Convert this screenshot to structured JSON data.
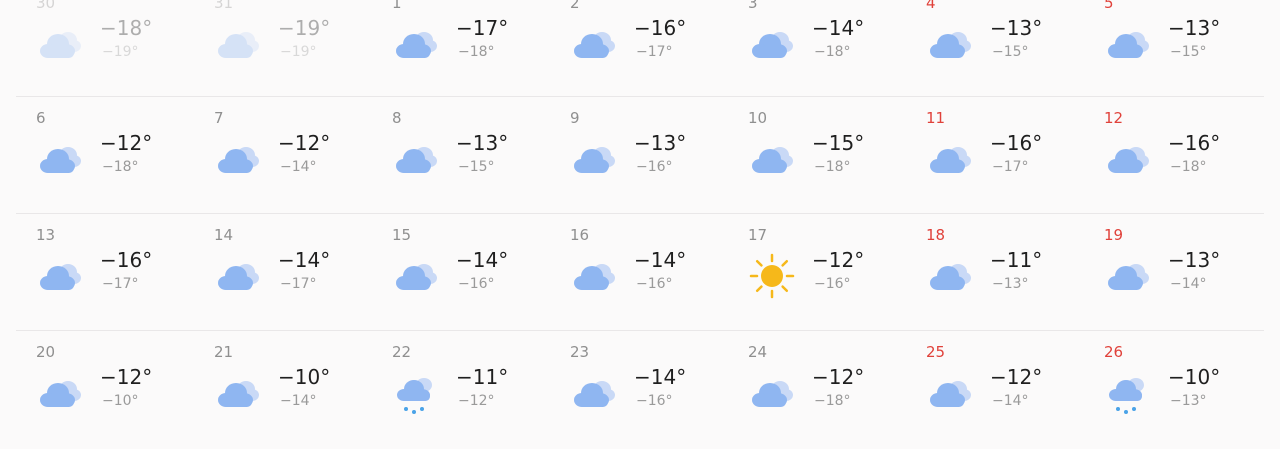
{
  "colors": {
    "weekend": "#e0413a",
    "cloud": "#8fb6f1",
    "cloud_back": "#c9d9f6",
    "sun": "#f6b81a",
    "snow": "#4aa3e8"
  },
  "weeks": [
    {
      "days": [
        {
          "day": "30",
          "icon": "cloudy-icon",
          "high": "−18°",
          "low": "−19°",
          "weekend": false,
          "faded": true
        },
        {
          "day": "31",
          "icon": "cloudy-icon",
          "high": "−19°",
          "low": "−19°",
          "weekend": false,
          "faded": true
        },
        {
          "day": "1",
          "icon": "cloudy-icon",
          "high": "−17°",
          "low": "−18°",
          "weekend": false,
          "faded": false
        },
        {
          "day": "2",
          "icon": "cloudy-icon",
          "high": "−16°",
          "low": "−17°",
          "weekend": false,
          "faded": false
        },
        {
          "day": "3",
          "icon": "cloudy-icon",
          "high": "−14°",
          "low": "−18°",
          "weekend": false,
          "faded": false
        },
        {
          "day": "4",
          "icon": "cloudy-icon",
          "high": "−13°",
          "low": "−15°",
          "weekend": true,
          "faded": false
        },
        {
          "day": "5",
          "icon": "cloudy-icon",
          "high": "−13°",
          "low": "−15°",
          "weekend": true,
          "faded": false
        }
      ]
    },
    {
      "days": [
        {
          "day": "6",
          "icon": "cloudy-icon",
          "high": "−12°",
          "low": "−18°",
          "weekend": false,
          "faded": false
        },
        {
          "day": "7",
          "icon": "cloudy-icon",
          "high": "−12°",
          "low": "−14°",
          "weekend": false,
          "faded": false
        },
        {
          "day": "8",
          "icon": "cloudy-icon",
          "high": "−13°",
          "low": "−15°",
          "weekend": false,
          "faded": false
        },
        {
          "day": "9",
          "icon": "cloudy-icon",
          "high": "−13°",
          "low": "−16°",
          "weekend": false,
          "faded": false
        },
        {
          "day": "10",
          "icon": "cloudy-icon",
          "high": "−15°",
          "low": "−18°",
          "weekend": false,
          "faded": false
        },
        {
          "day": "11",
          "icon": "cloudy-icon",
          "high": "−16°",
          "low": "−17°",
          "weekend": true,
          "faded": false
        },
        {
          "day": "12",
          "icon": "cloudy-icon",
          "high": "−16°",
          "low": "−18°",
          "weekend": true,
          "faded": false
        }
      ]
    },
    {
      "days": [
        {
          "day": "13",
          "icon": "cloudy-icon",
          "high": "−16°",
          "low": "−17°",
          "weekend": false,
          "faded": false
        },
        {
          "day": "14",
          "icon": "cloudy-icon",
          "high": "−14°",
          "low": "−17°",
          "weekend": false,
          "faded": false
        },
        {
          "day": "15",
          "icon": "cloudy-icon",
          "high": "−14°",
          "low": "−16°",
          "weekend": false,
          "faded": false
        },
        {
          "day": "16",
          "icon": "cloudy-icon",
          "high": "−14°",
          "low": "−16°",
          "weekend": false,
          "faded": false
        },
        {
          "day": "17",
          "icon": "sun-icon",
          "high": "−12°",
          "low": "−16°",
          "weekend": false,
          "faded": false
        },
        {
          "day": "18",
          "icon": "cloudy-icon",
          "high": "−11°",
          "low": "−13°",
          "weekend": true,
          "faded": false
        },
        {
          "day": "19",
          "icon": "cloudy-icon",
          "high": "−13°",
          "low": "−14°",
          "weekend": true,
          "faded": false
        }
      ]
    },
    {
      "days": [
        {
          "day": "20",
          "icon": "cloudy-icon",
          "high": "−12°",
          "low": "−10°",
          "weekend": false,
          "faded": false
        },
        {
          "day": "21",
          "icon": "cloudy-icon",
          "high": "−10°",
          "low": "−14°",
          "weekend": false,
          "faded": false
        },
        {
          "day": "22",
          "icon": "snow-icon",
          "high": "−11°",
          "low": "−12°",
          "weekend": false,
          "faded": false
        },
        {
          "day": "23",
          "icon": "cloudy-icon",
          "high": "−14°",
          "low": "−16°",
          "weekend": false,
          "faded": false
        },
        {
          "day": "24",
          "icon": "cloudy-icon",
          "high": "−12°",
          "low": "−18°",
          "weekend": false,
          "faded": false
        },
        {
          "day": "25",
          "icon": "cloudy-icon",
          "high": "−12°",
          "low": "−14°",
          "weekend": true,
          "faded": false
        },
        {
          "day": "26",
          "icon": "snow-icon",
          "high": "−10°",
          "low": "−13°",
          "weekend": true,
          "faded": false
        }
      ]
    }
  ]
}
